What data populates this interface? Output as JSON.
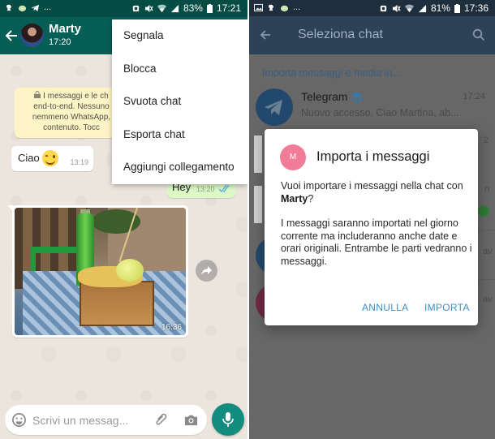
{
  "whatsapp": {
    "status_bar": {
      "left_icons": [
        "app-notification-icon",
        "cloud-icon",
        "telegram-icon"
      ],
      "overflow": "...",
      "right_icons": [
        "alarm-icon",
        "mute-icon",
        "wifi-icon",
        "signal-icon",
        "battery-icon"
      ],
      "battery": "83%",
      "time": "17:21"
    },
    "header": {
      "contact_name": "Marty",
      "last_seen": "17:20",
      "color": "#075e54"
    },
    "e2e_note": {
      "lines": [
        "I messaggi e le ch",
        "end-to-end. Nessuno",
        "nemmeno WhatsApp,",
        "contenuto. Tocc"
      ]
    },
    "messages": [
      {
        "direction": "incoming",
        "text": "Ciao",
        "emoji": "smiling-face",
        "time": "13:19"
      },
      {
        "direction": "outgoing",
        "text": "Hey",
        "time": "13:20",
        "status": "read"
      },
      {
        "direction": "incoming",
        "type": "image",
        "time": "16:36"
      }
    ],
    "menu": {
      "items": [
        "Segnala",
        "Blocca",
        "Svuota chat",
        "Esporta chat",
        "Aggiungi collegamento"
      ]
    },
    "composer": {
      "placeholder": "Scrivi un messag..."
    }
  },
  "telegram": {
    "status_bar": {
      "left_icons": [
        "image-icon",
        "app-notification-icon",
        "cloud-icon"
      ],
      "overflow": "...",
      "right_icons": [
        "alarm-icon",
        "mute-icon",
        "wifi-icon",
        "signal-icon",
        "battery-icon"
      ],
      "battery": "81%",
      "time": "17:36"
    },
    "header": {
      "title": "Seleziona chat"
    },
    "section_label": "Importa messaggi e media in...",
    "chats": [
      {
        "name": "Telegram",
        "verified": true,
        "time": "17:24",
        "preview": "Nuovo accesso. Ciao Martina, ab..."
      }
    ],
    "behind_fragments": [
      "2",
      "n",
      "av",
      "av"
    ],
    "dialog": {
      "avatar_initial": "M",
      "title": "Importa i messaggi",
      "question_prefix": "Vuoi importare i messaggi nella chat con ",
      "question_name": "Marty",
      "question_suffix": "?",
      "body": "I messaggi saranno importati nel giorno corrente ma includeranno anche date e orari originali. Entrambe le parti vedranno i messaggi.",
      "cancel_label": "ANNULLA",
      "confirm_label": "IMPORTA",
      "accent": "#3d8fc9"
    }
  }
}
